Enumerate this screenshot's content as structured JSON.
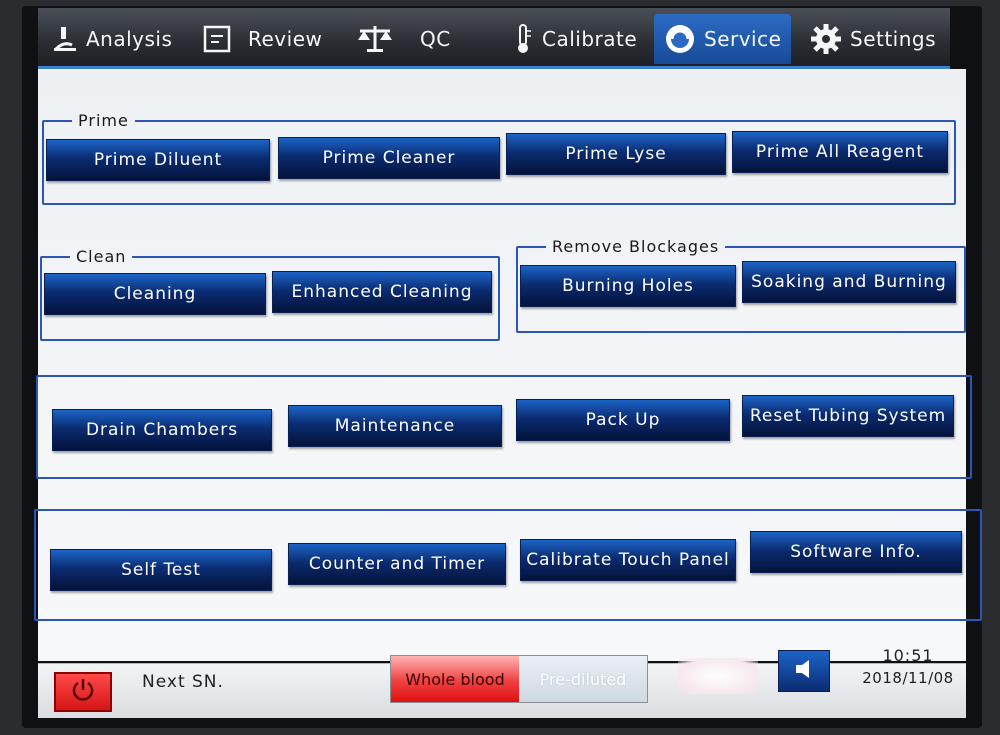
{
  "tabs": [
    {
      "label": "Analysis",
      "icon": "microscope-icon"
    },
    {
      "label": "Review",
      "icon": "document-icon"
    },
    {
      "label": "QC",
      "icon": "balance-scale-icon"
    },
    {
      "label": "Calibrate",
      "icon": "thermometer-icon"
    },
    {
      "label": "Service",
      "icon": "headset-icon",
      "active": true
    },
    {
      "label": "Settings",
      "icon": "gear-icon"
    }
  ],
  "prime": {
    "legend": "Prime",
    "buttons": [
      "Prime Diluent",
      "Prime Cleaner",
      "Prime Lyse",
      "Prime All Reagent"
    ]
  },
  "clean": {
    "legend": "Clean",
    "buttons": [
      "Cleaning",
      "Enhanced Cleaning"
    ]
  },
  "remove_blockages": {
    "legend": "Remove Blockages",
    "buttons": [
      "Burning Holes",
      "Soaking and Burning"
    ]
  },
  "misc_group_1": {
    "buttons": [
      "Drain Chambers",
      "Maintenance",
      "Pack Up",
      "Reset Tubing System"
    ]
  },
  "misc_group_2": {
    "buttons": [
      "Self Test",
      "Counter and Timer",
      "Calibrate Touch Panel",
      "Software Info."
    ]
  },
  "status": {
    "next_sn_label": "Next SN.",
    "mode_on": "Whole blood",
    "mode_off": "Pre-diluted",
    "time": "10:51",
    "date": "2018/11/08"
  },
  "colors": {
    "accent": "#2b56b8",
    "button_top": "#1d64c8",
    "button_bottom": "#04123a",
    "power": "#e01010"
  }
}
